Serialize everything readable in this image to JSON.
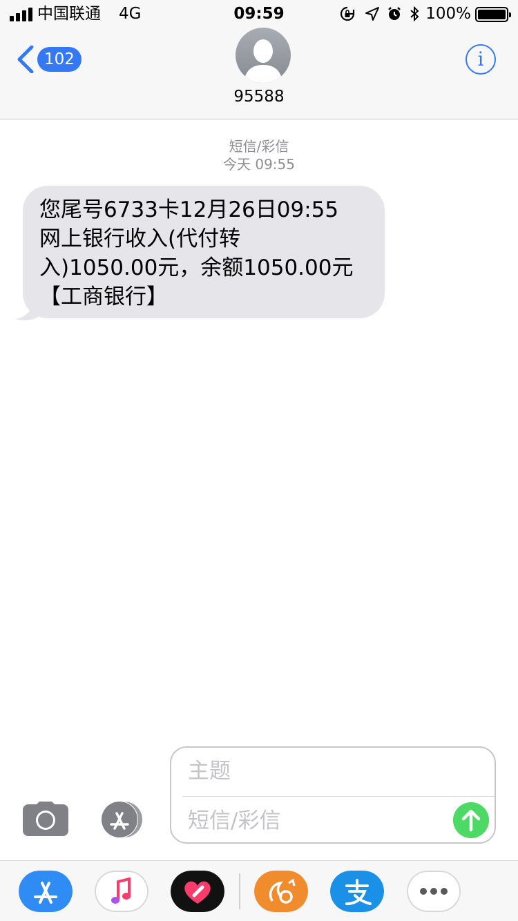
{
  "status_bar": {
    "carrier": "中国联通",
    "network": "4G",
    "time": "09:59",
    "battery_percent": "100%",
    "icons": [
      "signal-icon",
      "rotation-lock-icon",
      "location-arrow-icon",
      "alarm-icon",
      "bluetooth-icon",
      "battery-icon"
    ]
  },
  "header": {
    "back_badge": "102",
    "contact_name": "95588",
    "info_label": "i"
  },
  "conversation": {
    "message_type": "短信/彩信",
    "timestamp": "今天 09:55",
    "messages": [
      {
        "direction": "incoming",
        "text": "您尾号6733卡12月26日09:55\n网上银行收入(代付转\n入)1050.00元，余额1050.00元\n【工商银行】"
      }
    ]
  },
  "compose": {
    "subject_placeholder": "主题",
    "message_placeholder": "短信/彩信"
  },
  "app_drawer": {
    "apps": [
      "app-store-icon",
      "music-icon",
      "digital-touch-icon",
      "uc-browser-icon",
      "alipay-icon",
      "more-icon"
    ]
  },
  "colors": {
    "accent": "#3478f6",
    "bubble_incoming": "#e5e5ea",
    "send_button": "#4cd964",
    "meta_text": "#8e8e93"
  }
}
